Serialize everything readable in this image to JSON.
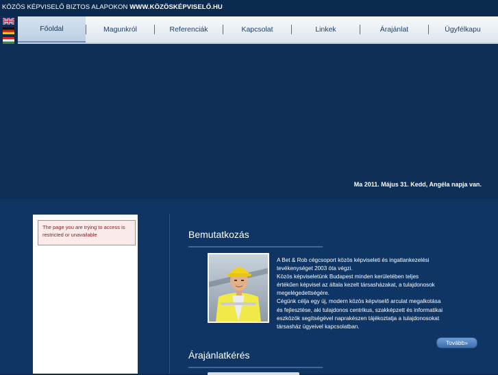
{
  "header": {
    "tagline_prefix": "KÖZÖS KÉPVISELŐ BIZTOS ALAPOKON",
    "tagline_url": "WWW.KÖZÖSKÉPVISELŐ.HU"
  },
  "languages": [
    {
      "code": "en",
      "icon": "uk-flag-icon"
    },
    {
      "code": "de",
      "icon": "german-flag-icon"
    },
    {
      "code": "hu",
      "icon": "hungarian-flag-icon"
    }
  ],
  "nav": {
    "items": [
      {
        "label": "Főoldal",
        "active": true
      },
      {
        "label": "Magunkról",
        "active": false
      },
      {
        "label": "Referenciák",
        "active": false
      },
      {
        "label": "Kapcsolat",
        "active": false
      },
      {
        "label": "Linkek",
        "active": false
      },
      {
        "label": "Árajánlat",
        "active": false
      },
      {
        "label": "Ügyfélkapu",
        "active": false
      }
    ]
  },
  "banner": {
    "date_line": "Ma 2011. Május 31. Kedd, Angéla napja van."
  },
  "sidebar": {
    "error_message": "The page you are trying to access is restricted or unavailable"
  },
  "intro": {
    "title": "Bemutatkozás",
    "paragraphs": [
      "A Bet & Rob cégcsoport közös képviseleti és ingatlankezelési tevékenységet 2003 óta végzi.",
      "Közös képviseletünk Budapest minden kerületében teljes értékűen képvisel az általa kezelt társasházakat, a tulajdonosok megelégedettségére.",
      "Cégünk célja egy új, modern közös képviselő arculat megalkotása és fejlesztése, aki tulajdonos centrikus, szakképzett és informatikai eszközök segítségével naprakészen tájékoztatja a tulajdonosokat társasház ügyeivel kapcsolatban."
    ],
    "more_label": "Tovább»"
  },
  "quote": {
    "title": "Árajánlatkérés"
  },
  "colors": {
    "page_bg": "#0d2c52",
    "content_bg": "#0e3564",
    "nav_text": "#1b3e6a",
    "button": "#4a7cbd",
    "error_border": "#d97a7a"
  }
}
